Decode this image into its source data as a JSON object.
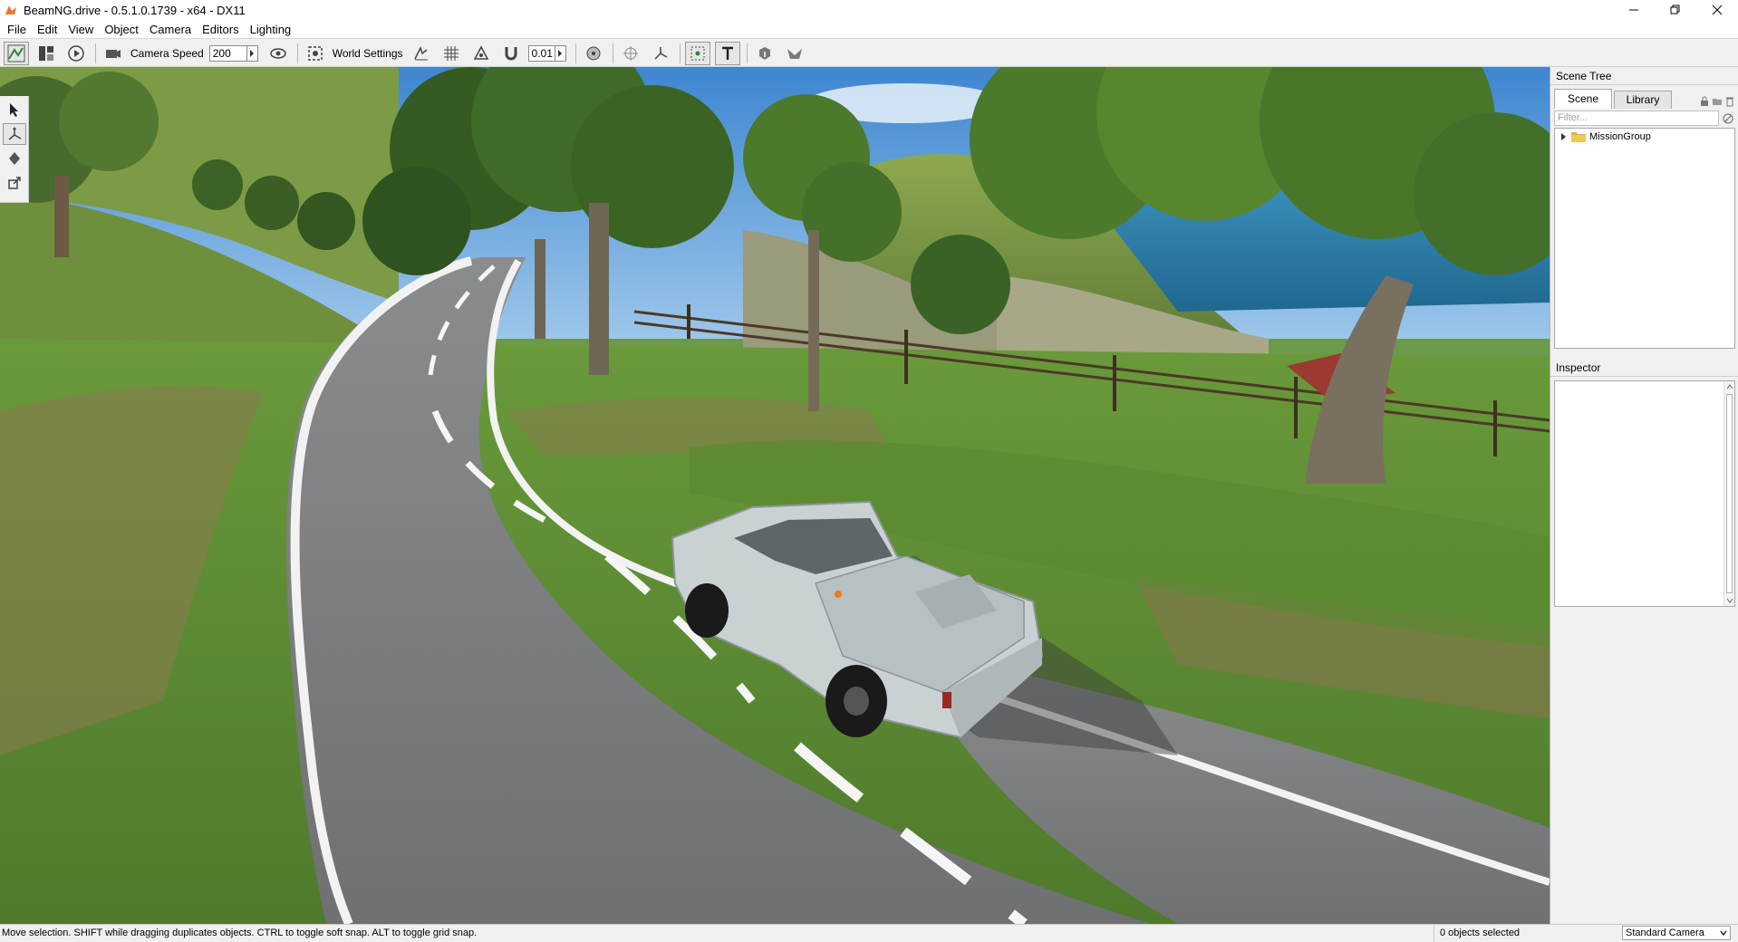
{
  "window": {
    "title": "BeamNG.drive - 0.5.1.0.1739 - x64 - DX11",
    "app_icon": "beamng-logo-icon",
    "controls": [
      "minimize-icon",
      "restore-icon",
      "close-icon"
    ]
  },
  "menu": {
    "items": [
      "File",
      "Edit",
      "View",
      "Object",
      "Camera",
      "Editors",
      "Lighting"
    ]
  },
  "toolbar": {
    "camera_speed_label": "Camera Speed",
    "camera_speed_value": "200",
    "world_settings_label": "World Settings",
    "snap_value": "0.01"
  },
  "scene_tree": {
    "title": "Scene Tree",
    "tabs": [
      "Scene",
      "Library"
    ],
    "active_tab": "Scene",
    "filter_placeholder": "Filter...",
    "items": [
      {
        "label": "MissionGroup",
        "expanded": false
      }
    ]
  },
  "inspector": {
    "title": "Inspector"
  },
  "status": {
    "hint": "Move selection.  SHIFT while dragging duplicates objects.  CTRL to toggle soft snap.  ALT to toggle grid snap.",
    "selection_count": "0 objects selected",
    "camera_mode": "Standard Camera"
  },
  "colors": {
    "road": "#7c7e80",
    "grass": "#6a9a4a",
    "sky": "#5f9fd8",
    "sea": "#2b7ba8",
    "truck": "#c8d0d2"
  }
}
